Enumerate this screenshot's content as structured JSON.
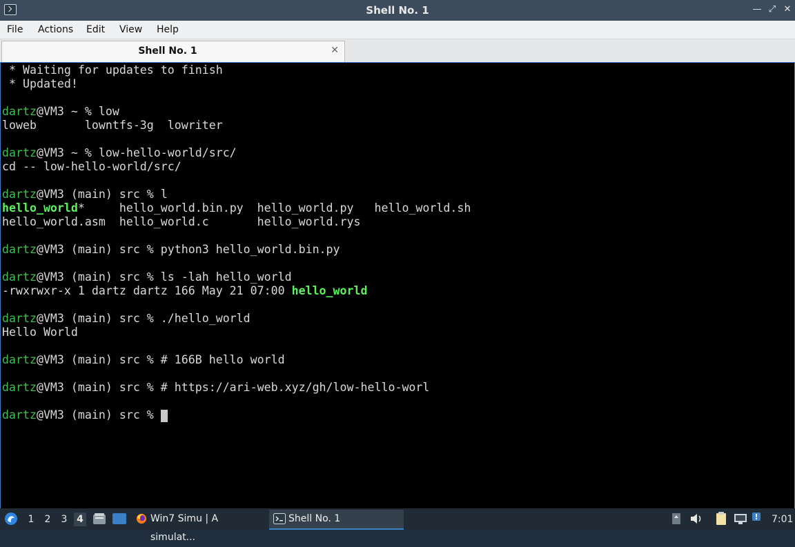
{
  "window": {
    "title": "Shell No. 1",
    "controls": {
      "minimize": "—",
      "restore": "⤢",
      "close": "✕"
    }
  },
  "menu": [
    "File",
    "Actions",
    "Edit",
    "View",
    "Help"
  ],
  "tab": {
    "label": "Shell No. 1",
    "close": "✕"
  },
  "terminal": {
    "lines": [
      {
        "segments": [
          {
            "t": " * Waiting for updates to finish",
            "c": ""
          }
        ]
      },
      {
        "segments": [
          {
            "t": " * Updated!",
            "c": ""
          }
        ]
      },
      {
        "segments": []
      },
      {
        "segments": [
          {
            "t": "dartz",
            "c": "u"
          },
          {
            "t": "@VM3 ~ % low",
            "c": ""
          }
        ]
      },
      {
        "segments": [
          {
            "t": "loweb       lowntfs-3g  lowriter",
            "c": ""
          }
        ]
      },
      {
        "segments": []
      },
      {
        "segments": [
          {
            "t": "dartz",
            "c": "u"
          },
          {
            "t": "@VM3 ~ % low-hello-world/src/",
            "c": ""
          }
        ]
      },
      {
        "segments": [
          {
            "t": "cd -- low-hello-world/src/",
            "c": ""
          }
        ]
      },
      {
        "segments": []
      },
      {
        "segments": [
          {
            "t": "dartz",
            "c": "u"
          },
          {
            "t": "@VM3 (main) src % l",
            "c": ""
          }
        ]
      },
      {
        "segments": [
          {
            "t": "hello_world",
            "c": "exe"
          },
          {
            "t": "*     hello_world.bin.py  hello_world.py   hello_world.sh",
            "c": ""
          }
        ]
      },
      {
        "segments": [
          {
            "t": "hello_world.asm  hello_world.c       hello_world.rys",
            "c": ""
          }
        ]
      },
      {
        "segments": []
      },
      {
        "segments": [
          {
            "t": "dartz",
            "c": "u"
          },
          {
            "t": "@VM3 (main) src % python3 hello_world.bin.py",
            "c": ""
          }
        ]
      },
      {
        "segments": []
      },
      {
        "segments": [
          {
            "t": "dartz",
            "c": "u"
          },
          {
            "t": "@VM3 (main) src % ls -lah hello_world",
            "c": ""
          }
        ]
      },
      {
        "segments": [
          {
            "t": "-rwxrwxr-x 1 dartz dartz 166 May 21 07:00 ",
            "c": ""
          },
          {
            "t": "hello_world",
            "c": "exe"
          }
        ]
      },
      {
        "segments": []
      },
      {
        "segments": [
          {
            "t": "dartz",
            "c": "u"
          },
          {
            "t": "@VM3 (main) src % ./hello_world",
            "c": ""
          }
        ]
      },
      {
        "segments": [
          {
            "t": "Hello World",
            "c": ""
          }
        ]
      },
      {
        "segments": []
      },
      {
        "segments": [
          {
            "t": "dartz",
            "c": "u"
          },
          {
            "t": "@VM3 (main) src % # 166B hello world",
            "c": ""
          }
        ]
      },
      {
        "segments": []
      },
      {
        "segments": [
          {
            "t": "dartz",
            "c": "u"
          },
          {
            "t": "@VM3 (main) src % # https://ari-web.xyz/gh/low-hello-worl",
            "c": ""
          }
        ]
      },
      {
        "segments": []
      },
      {
        "segments": [
          {
            "t": "dartz",
            "c": "u"
          },
          {
            "t": "@VM3 (main) src % ",
            "c": ""
          },
          {
            "t": "",
            "c": "cursor"
          }
        ]
      }
    ]
  },
  "taskbar": {
    "start_icon": "lxqt-start-icon",
    "workspaces": [
      "1",
      "2",
      "3",
      "4"
    ],
    "active_workspace": "4",
    "tasks": [
      {
        "label": "Win7 Simu | A simulat...",
        "icon": "firefox-icon"
      },
      {
        "label": "Shell No. 1",
        "icon": "terminal-icon"
      }
    ],
    "clock": "7:01"
  }
}
